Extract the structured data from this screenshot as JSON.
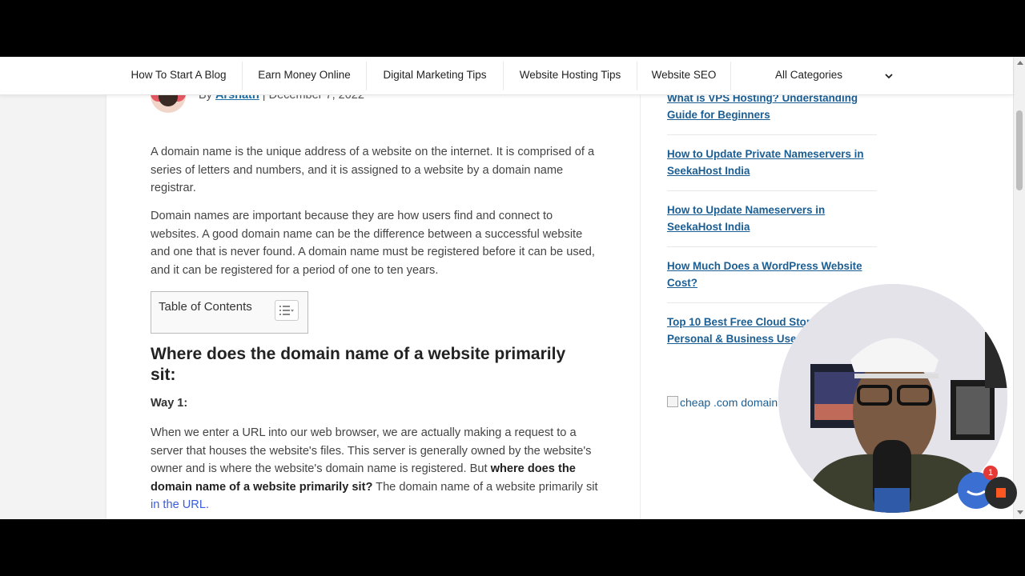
{
  "nav": {
    "items": [
      "How To Start A Blog",
      "Earn Money Online",
      "Digital Marketing Tips",
      "Website Hosting Tips",
      "Website SEO"
    ],
    "categories_select": "All Categories"
  },
  "article": {
    "byline_prefix": "By",
    "author": "Arshath",
    "separator": "|",
    "date": "December 7, 2022",
    "para1": "A domain name is the unique address of a website on the internet. It is comprised of a series of letters and numbers, and it is assigned to a website by a domain name registrar.",
    "para2": "Domain names are important because they are how users find and connect to websites. A good domain name can be the difference between a successful website and one that is never found. A domain name must be registered before it can be used, and it can be registered for a period of one to ten years.",
    "toc_title": "Table of Contents",
    "heading": "Where does the domain name of a website primarily sit:",
    "way_label": "Way 1:",
    "para3_a": "When we enter a URL into our web browser, we are actually making a request to a server that houses the website's files. This server is generally owned by the website's owner and is where the website's domain name is registered. But ",
    "para3_b": "where does the domain name of a website primarily sit?",
    "para3_c": " The domain name of a website primarily sit ",
    "para3_link": "in the URL.",
    "para3_end": ""
  },
  "sidebar": {
    "links": [
      "What is VPS Hosting? Understanding Guide for Beginners",
      "How to Update Private Nameservers in SeekaHost India",
      "How to Update Nameservers in SeekaHost India",
      "How Much Does a WordPress Website Cost?",
      "Top 10 Best Free Cloud Storage for Personal & Business Use"
    ],
    "image_alt": "cheap .com domain"
  },
  "chat": {
    "badge_count": "1"
  },
  "colors": {
    "link": "#1b5e93",
    "author_link": "#1b6ea5",
    "inline_link": "#3b5bdb",
    "chat": "#3b6fd1",
    "badge": "#e53935"
  }
}
